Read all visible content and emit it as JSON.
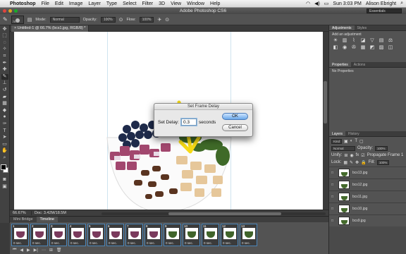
{
  "menubar": {
    "app": "Photoshop",
    "items": [
      "File",
      "Edit",
      "Image",
      "Layer",
      "Type",
      "Select",
      "Filter",
      "3D",
      "View",
      "Window",
      "Help"
    ],
    "clock": "Sun 3:03 PM",
    "user": "Alison Ebright"
  },
  "window": {
    "title": "Adobe Photoshop CS6",
    "workspace": "Essentials"
  },
  "options": {
    "mode_label": "Mode:",
    "mode_value": "Normal",
    "opacity_label": "Opacity:",
    "opacity_value": "100%",
    "flow_label": "Flow:",
    "flow_value": "100%",
    "brush_size": "70"
  },
  "document": {
    "tab_title": "Untitled-1 @ 66.7% (bcs1.jpg, RGB/8) *",
    "zoom": "66.67%",
    "doc_info": "Doc: 3.42M/18.5M"
  },
  "timeline": {
    "tabs": [
      "Mini Bridge",
      "Timeline"
    ],
    "frames": [
      {
        "num": "1",
        "delay": "0 sec."
      },
      {
        "num": "2",
        "delay": "0 sec."
      },
      {
        "num": "3",
        "delay": "0 sec."
      },
      {
        "num": "4",
        "delay": "0 sec."
      },
      {
        "num": "5",
        "delay": "0 sec."
      },
      {
        "num": "6",
        "delay": "0 sec."
      },
      {
        "num": "7",
        "delay": "0 sec."
      },
      {
        "num": "8",
        "delay": "0 sec."
      },
      {
        "num": "9",
        "delay": "0 sec."
      },
      {
        "num": "10",
        "delay": "0 sec."
      },
      {
        "num": "11",
        "delay": "0 sec."
      },
      {
        "num": "12",
        "delay": "0 sec."
      },
      {
        "num": "13",
        "delay": "0 sec."
      }
    ]
  },
  "panels": {
    "adjustments_tab": "Adjustments",
    "styles_tab": "Styles",
    "add_adjustment": "Add an adjustment",
    "properties_tab": "Properties",
    "actions_tab": "Actions",
    "no_properties": "No Properties",
    "layers_tab": "Layers",
    "history_tab": "History",
    "kind": "Kind",
    "blend_mode": "Normal",
    "opacity_label": "Opacity:",
    "opacity_value": "100%",
    "unify_label": "Unify:",
    "propagate_label": "Propagate Frame 1",
    "lock_label": "Lock:",
    "fill_label": "Fill:",
    "fill_value": "100%",
    "layers": [
      "bcs13.jpg",
      "bcs12.jpg",
      "bcs11.jpg",
      "bcs10.jpg",
      "bcs9.jpg"
    ]
  },
  "dialog": {
    "title": "Set Frame Delay",
    "label": "Set Delay:",
    "value": "0.3",
    "unit": "seconds",
    "ok": "OK",
    "cancel": "Cancel"
  }
}
